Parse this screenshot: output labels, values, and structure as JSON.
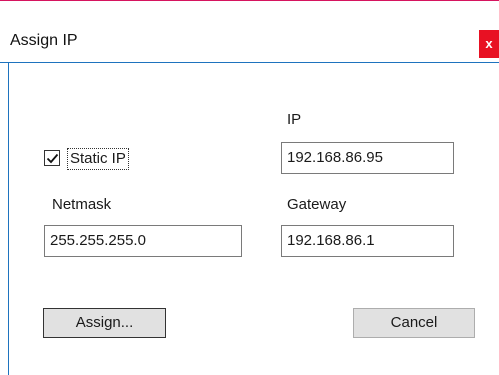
{
  "window": {
    "title": "Assign IP",
    "close_label": "x"
  },
  "form": {
    "static_ip": {
      "label": "Static IP",
      "checked": true
    },
    "ip": {
      "label": "IP",
      "value": "192.168.86.95"
    },
    "netmask": {
      "label": "Netmask",
      "value": "255.255.255.0"
    },
    "gateway": {
      "label": "Gateway",
      "value": "192.168.86.1"
    }
  },
  "buttons": {
    "assign_label": "Assign...",
    "cancel_label": "Cancel"
  },
  "colors": {
    "accent_top": "#d6145f",
    "accent_border": "#1e73be",
    "close_bg": "#e81123"
  }
}
